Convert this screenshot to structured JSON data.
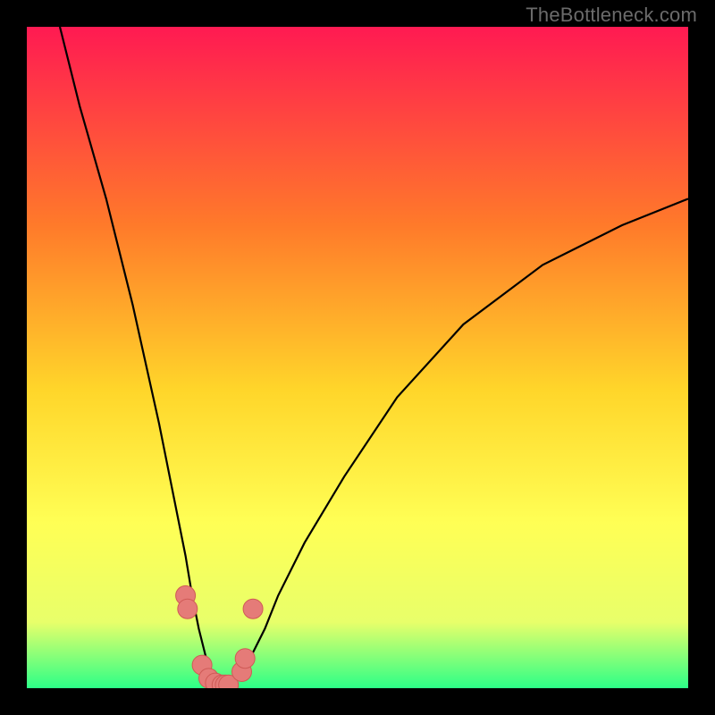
{
  "watermark": "TheBottleneck.com",
  "colors": {
    "page_bg": "#000000",
    "grad_top": "#ff1a52",
    "grad_mid1": "#ff7a2a",
    "grad_mid2": "#ffd62a",
    "grad_mid3": "#ffff55",
    "grad_mid4": "#e8ff6a",
    "grad_bottom": "#2cff87",
    "curve": "#000000",
    "dot_fill": "#e57b78",
    "dot_stroke": "#cf5a56",
    "watermark": "#6b6b6b"
  },
  "chart_data": {
    "type": "line",
    "title": "",
    "xlabel": "",
    "ylabel": "",
    "xlim": [
      0,
      100
    ],
    "ylim": [
      0,
      100
    ],
    "grid": false,
    "legend": false,
    "series": [
      {
        "name": "bottleneck-curve",
        "x": [
          5,
          8,
          12,
          16,
          20,
          22,
          24,
          25,
          26,
          27,
          28,
          29,
          30,
          31,
          32,
          34,
          36,
          38,
          42,
          48,
          56,
          66,
          78,
          90,
          100
        ],
        "y": [
          100,
          88,
          74,
          58,
          40,
          30,
          20,
          14,
          9,
          5,
          2,
          0.5,
          0,
          0.5,
          2,
          5,
          9,
          14,
          22,
          32,
          44,
          55,
          64,
          70,
          74
        ]
      }
    ],
    "scatter_points": {
      "name": "highlight-dots",
      "x": [
        24,
        24.3,
        26.5,
        27.5,
        28.5,
        29.5,
        30,
        30.5,
        32.5,
        33,
        34.2
      ],
      "y": [
        14,
        12,
        3.5,
        1.5,
        0.8,
        0.5,
        0.5,
        0.5,
        2.5,
        4.5,
        12
      ]
    }
  }
}
